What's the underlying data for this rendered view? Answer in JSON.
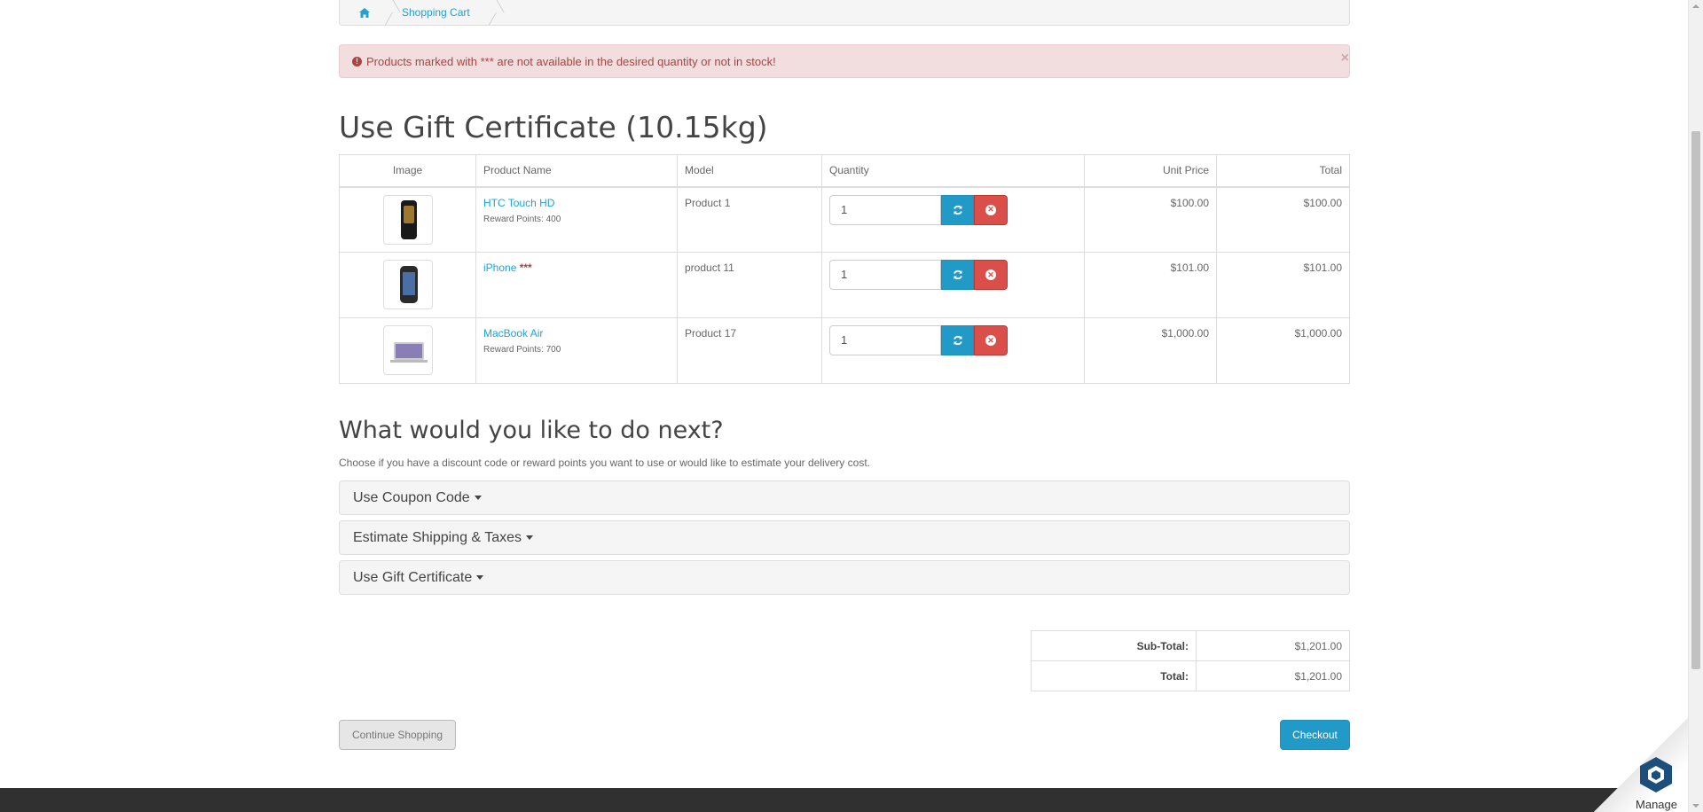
{
  "breadcrumb": {
    "home_icon": "home-icon",
    "current": "Shopping Cart"
  },
  "alert": {
    "icon": "exclamation-circle-icon",
    "message": "Products marked with *** are not available in the desired quantity or not in stock!",
    "close": "×"
  },
  "title": "Use Gift Certificate  (10.15kg)",
  "cart": {
    "headers": {
      "image": "Image",
      "name": "Product Name",
      "model": "Model",
      "quantity": "Quantity",
      "unit_price": "Unit Price",
      "total": "Total"
    },
    "rows": [
      {
        "name": "HTC Touch HD",
        "stock_mark": "",
        "reward": "Reward Points: 400",
        "model": "Product 1",
        "quantity": "1",
        "unit_price": "$100.00",
        "total": "$100.00",
        "image_icon": "htc-phone-thumbnail"
      },
      {
        "name": "iPhone",
        "stock_mark": "***",
        "reward": "",
        "model": "product 11",
        "quantity": "1",
        "unit_price": "$101.00",
        "total": "$101.00",
        "image_icon": "iphone-thumbnail"
      },
      {
        "name": "MacBook Air",
        "stock_mark": "",
        "reward": "Reward Points: 700",
        "model": "Product 17",
        "quantity": "1",
        "unit_price": "$1,000.00",
        "total": "$1,000.00",
        "image_icon": "macbook-thumbnail"
      }
    ]
  },
  "next": {
    "heading": "What would you like to do next?",
    "description": "Choose if you have a discount code or reward points you want to use or would like to estimate your delivery cost.",
    "panels": [
      "Use Coupon Code",
      "Estimate Shipping & Taxes",
      "Use Gift Certificate"
    ]
  },
  "totals": [
    {
      "label": "Sub-Total:",
      "value": "$1,201.00"
    },
    {
      "label": "Total:",
      "value": "$1,201.00"
    }
  ],
  "buttons": {
    "continue": "Continue Shopping",
    "checkout": "Checkout"
  },
  "manage": {
    "label": "Manage"
  },
  "colors": {
    "link": "#23a1d1",
    "primary": "#229ac8",
    "danger": "#da4f49",
    "alert_bg": "#f2dede",
    "footer": "#303030"
  }
}
